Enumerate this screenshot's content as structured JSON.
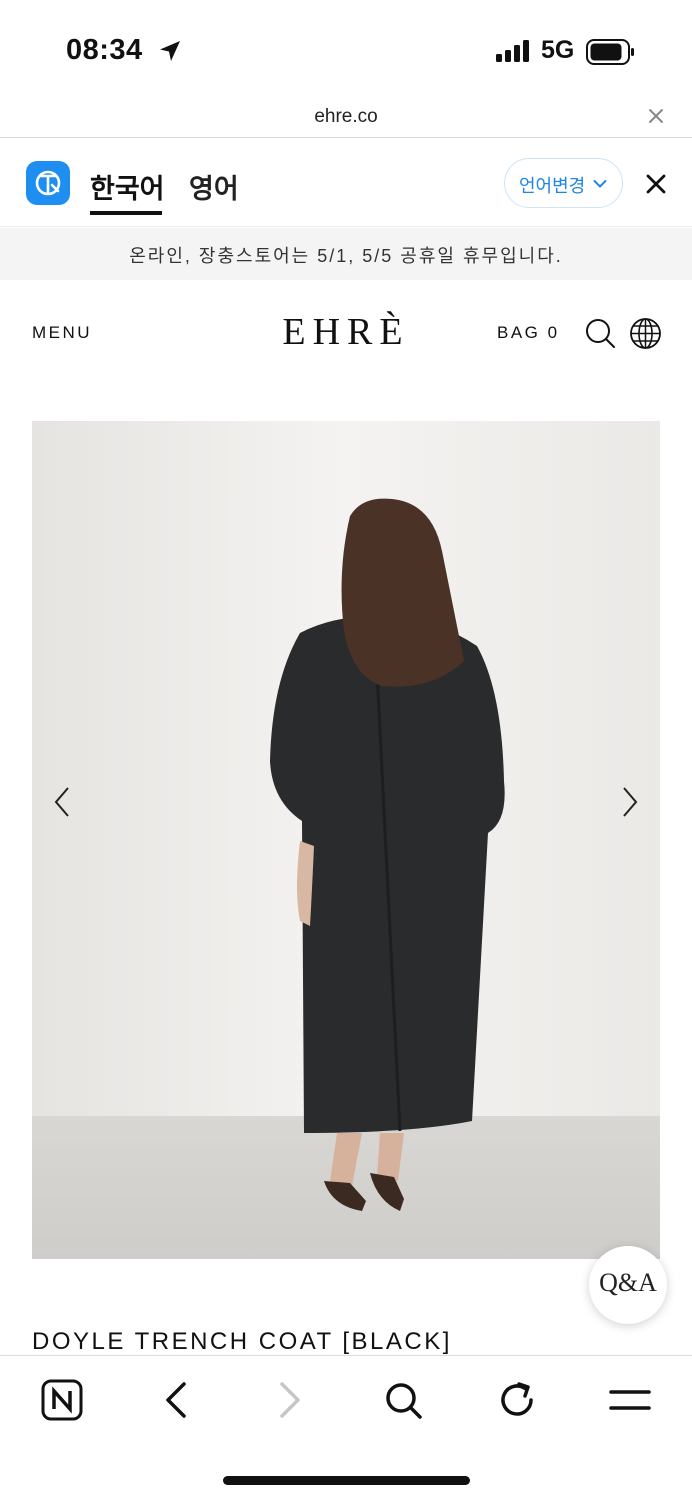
{
  "status_bar": {
    "time": "08:34",
    "network": "5G",
    "icons": [
      "location-arrow-icon",
      "signal-icon",
      "battery-icon"
    ]
  },
  "browser": {
    "url": "ehre.co"
  },
  "translate_bar": {
    "tabs": [
      {
        "label": "한국어",
        "active": true
      },
      {
        "label": "영어",
        "active": false
      }
    ],
    "change_language_label": "언어변경",
    "accent_color": "#1e8ff0"
  },
  "notice": {
    "text": "온라인, 장충스토어는 5/1, 5/5 공휴일 휴무입니다."
  },
  "header": {
    "menu_label": "MENU",
    "logo": "EHRÈ",
    "bag_label": "BAG 0"
  },
  "product": {
    "title": "DOYLE TRENCH COAT [BLACK]"
  },
  "floating": {
    "qa_label": "Q&A"
  },
  "toolbar": {
    "buttons": [
      "naver-home-icon",
      "back-icon",
      "forward-icon",
      "search-icon",
      "reload-icon",
      "menu-icon"
    ]
  }
}
